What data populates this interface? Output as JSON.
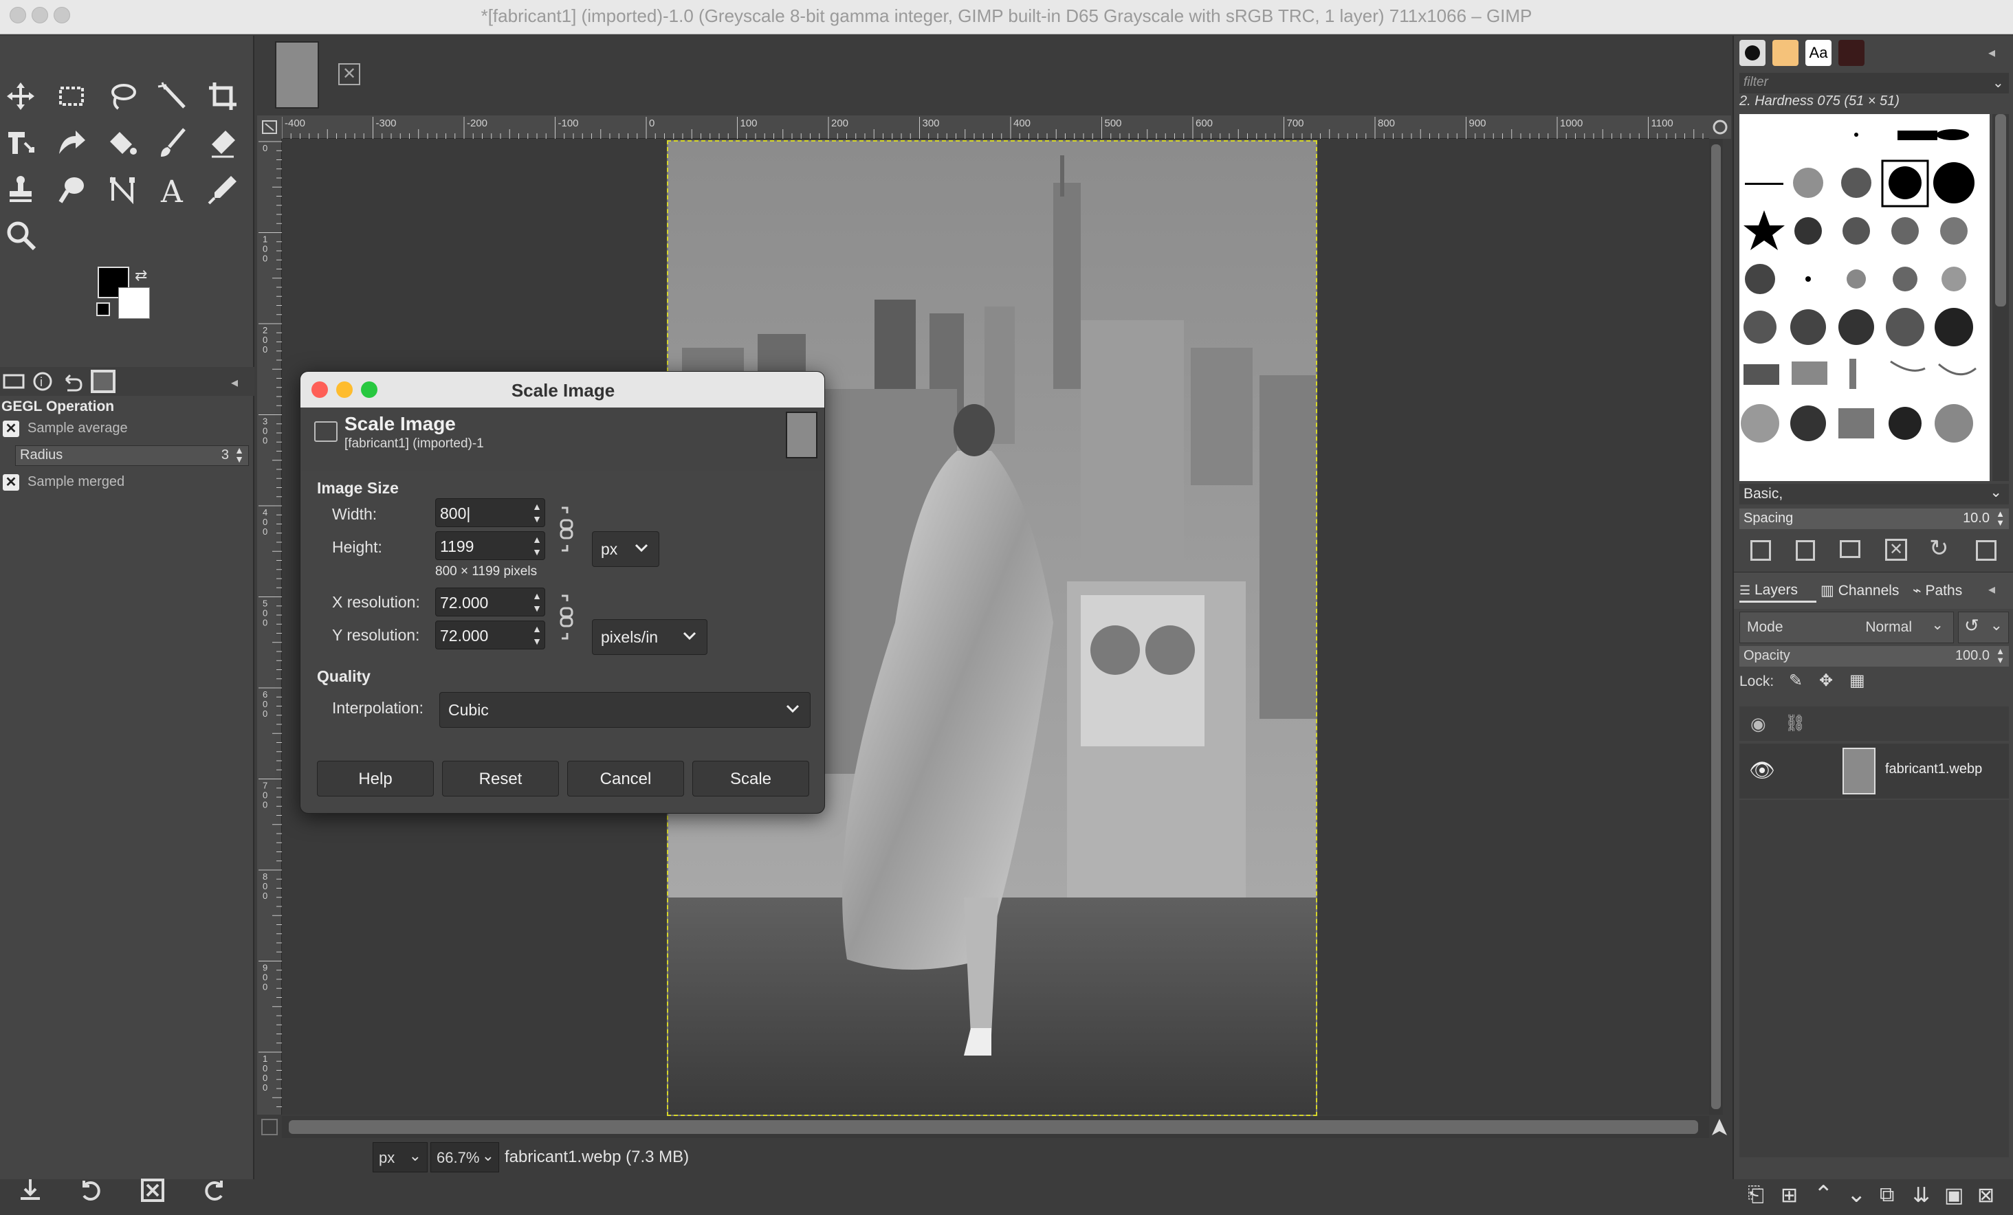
{
  "window": {
    "title": "*[fabricant1] (imported)-1.0 (Greyscale 8-bit gamma integer, GIMP built-in D65 Grayscale with sRGB TRC, 1 layer) 711x1066 – GIMP"
  },
  "toolbox": {
    "tools": [
      "move-tool",
      "rect-select-tool",
      "free-select-tool",
      "fuzzy-select-tool",
      "crop-tool",
      "unified-transform-tool",
      "warp-transform-tool",
      "bucket-fill-tool",
      "paintbrush-tool",
      "eraser-tool",
      "clone-tool",
      "smudge-tool",
      "paths-tool",
      "text-tool",
      "color-picker-tool",
      "zoom-tool"
    ],
    "fg_color": "#000000",
    "bg_color": "#ffffff"
  },
  "tool_options": {
    "title": "GEGL Operation",
    "sample_average": "Sample average",
    "radius_label": "Radius",
    "radius_value": "3",
    "sample_merged": "Sample merged"
  },
  "ruler": {
    "h_ticks": [
      "-400",
      "-300",
      "-200",
      "-100",
      "0",
      "100",
      "200",
      "300",
      "400",
      "500",
      "600",
      "700",
      "800",
      "900",
      "1000",
      "1100"
    ],
    "v_ticks": [
      "0",
      "1\n0\n0",
      "2\n0\n0",
      "3\n0\n0",
      "4\n0\n0",
      "5\n0\n0",
      "6\n0\n0",
      "7\n0\n0",
      "8\n0\n0",
      "9\n0\n0",
      "1\n0\n0\n0"
    ]
  },
  "statusbar": {
    "unit": "px",
    "zoom": "66.7%",
    "text": "fabricant1.webp (7.3 MB)"
  },
  "brushes": {
    "filter_placeholder": "filter",
    "selected": "2. Hardness 075 (51 × 51)",
    "preset": "Basic,",
    "spacing_label": "Spacing",
    "spacing_value": "10.0"
  },
  "layers": {
    "tabs": [
      "Layers",
      "Channels",
      "Paths"
    ],
    "mode_label": "Mode",
    "mode_value": "Normal",
    "opacity_label": "Opacity",
    "opacity_value": "100.0",
    "lock_label": "Lock:",
    "layer_name": "fabricant1.webp"
  },
  "dialog": {
    "title": "Scale Image",
    "heading": "Scale Image",
    "subheading": "[fabricant1] (imported)-1",
    "image_size_label": "Image Size",
    "width_label": "Width:",
    "width_value": "800|",
    "height_label": "Height:",
    "height_value": "1199",
    "pixels_text": "800 × 1199 pixels",
    "size_unit": "px",
    "xres_label": "X resolution:",
    "xres_value": "72.000",
    "yres_label": "Y resolution:",
    "yres_value": "72.000",
    "res_unit": "pixels/in",
    "quality_label": "Quality",
    "interp_label": "Interpolation:",
    "interp_value": "Cubic",
    "buttons": {
      "help": "Help",
      "reset": "Reset",
      "cancel": "Cancel",
      "scale": "Scale"
    }
  },
  "colors": {
    "close": "#fe5f57",
    "minimize": "#febc2e",
    "zoom": "#28c840",
    "selection": "#d7d72a"
  }
}
